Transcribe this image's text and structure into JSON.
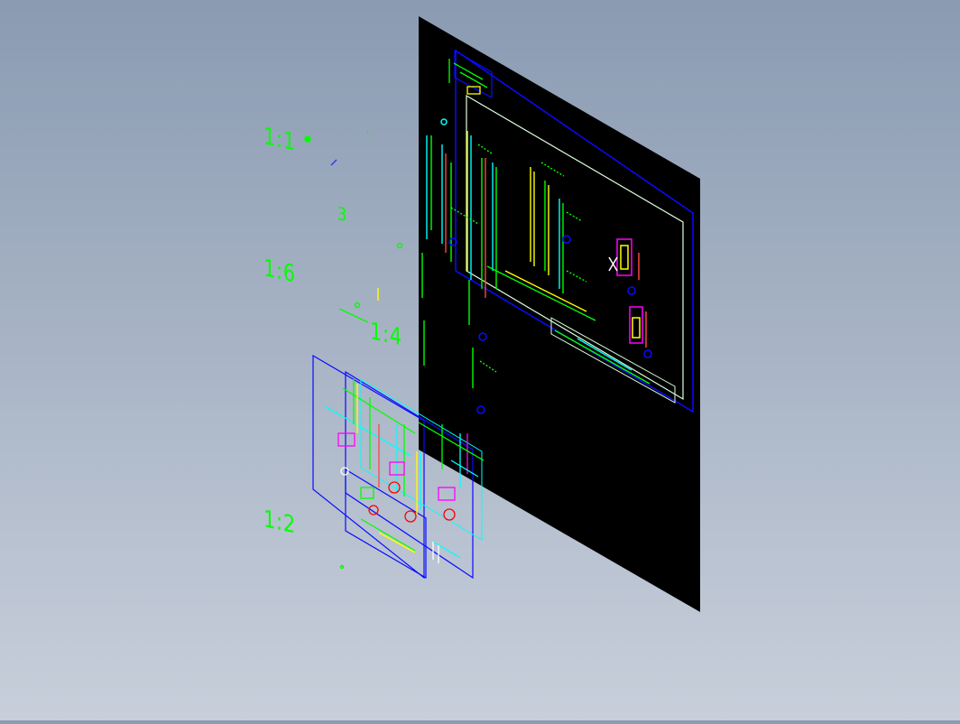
{
  "scale_labels": [
    "1:1",
    "1:6",
    "1:4",
    "1:2"
  ],
  "small_labels": [
    "3"
  ],
  "colors": {
    "sheet": "#000000",
    "frame": "#0000ff",
    "inner_frame": "#ffffff",
    "green": "#00ff00",
    "cyan": "#00ffff",
    "yellow": "#ffff00",
    "magenta": "#ff00ff",
    "red": "#ff0000"
  }
}
